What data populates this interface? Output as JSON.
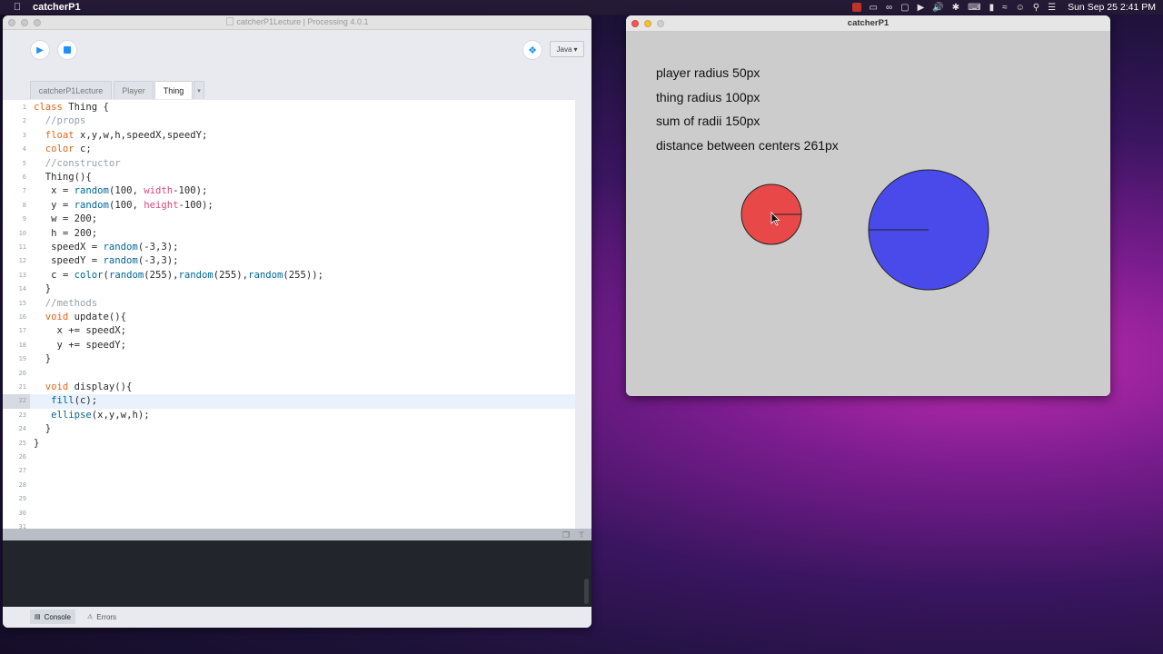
{
  "menubar": {
    "app_name": "catcherP1",
    "clock": "Sun Sep 25  2:41 PM"
  },
  "ide": {
    "title": "catcherP1Lecture | Processing 4.0.1",
    "mode_label": "Java",
    "tabs": [
      "catcherP1Lecture",
      "Player",
      "Thing"
    ],
    "active_tab": "Thing",
    "code_lines": [
      "class Thing {",
      "  //props",
      "  float x,y,w,h,speedX,speedY;",
      "  color c;",
      "  //constructor",
      "  Thing(){",
      "   x = random(100, width-100);",
      "   y = random(100, height-100);",
      "   w = 200;",
      "   h = 200;",
      "   speedX = random(-3,3);",
      "   speedY = random(-3,3);",
      "   c = color(random(255),random(255),random(255));",
      "  }",
      "  //methods",
      "  void update(){",
      "    x += speedX;",
      "    y += speedY;",
      "  }",
      "",
      "  void display(){",
      "   fill(c);",
      "   ellipse(x,y,w,h);",
      "  }",
      "}",
      "",
      "",
      "",
      "",
      "",
      ""
    ],
    "line_numbers": [
      "1",
      "2",
      "3",
      "4",
      "5",
      "6",
      "7",
      "8",
      "9",
      "10",
      "11",
      "12",
      "13",
      "14",
      "15",
      "16",
      "17",
      "18",
      "19",
      "20",
      "21",
      "22",
      "23",
      "24",
      "25",
      "26",
      "27",
      "28",
      "29",
      "30",
      "31"
    ],
    "current_line": 22,
    "console_tab": "Console",
    "errors_tab": "Errors"
  },
  "sketch": {
    "title": "catcherP1",
    "info_lines": [
      "player radius 50px",
      "thing radius 100px",
      "sum of radii 150px",
      "distance between centers 261px"
    ],
    "player_color": "#e84848",
    "thing_color": "#4a4aeb"
  }
}
